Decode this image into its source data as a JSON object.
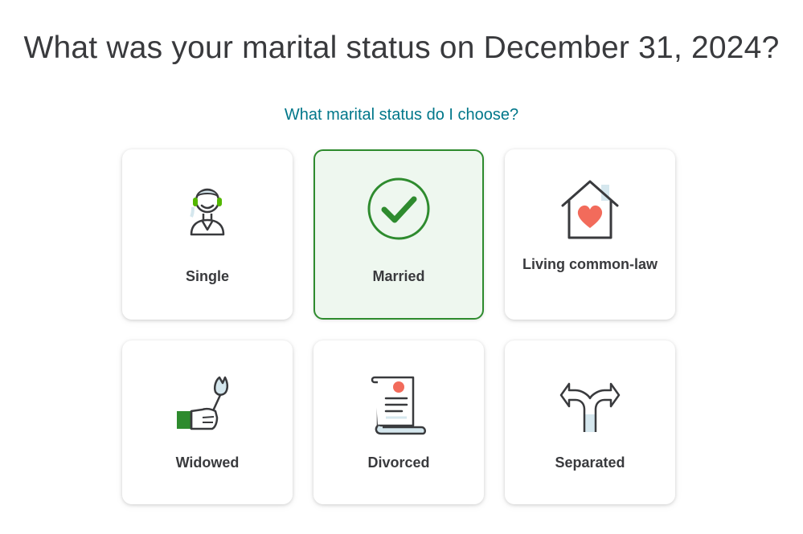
{
  "question": "What was your marital status on December 31, 2024?",
  "help_link": "What marital status do I choose?",
  "options": [
    {
      "label": "Single",
      "icon": "single-person-icon"
    },
    {
      "label": "Married",
      "icon": "checkmark-circle-icon",
      "selected": true
    },
    {
      "label": "Living common-law",
      "icon": "house-heart-icon"
    },
    {
      "label": "Widowed",
      "icon": "hand-flower-icon"
    },
    {
      "label": "Divorced",
      "icon": "certificate-scroll-icon"
    },
    {
      "label": "Separated",
      "icon": "split-arrows-icon"
    }
  ],
  "colors": {
    "accent_green": "#2e8b2e",
    "selected_bg": "#eef7ef",
    "link_teal": "#00778a",
    "text": "#393a3d",
    "heart": "#f26b5b"
  }
}
